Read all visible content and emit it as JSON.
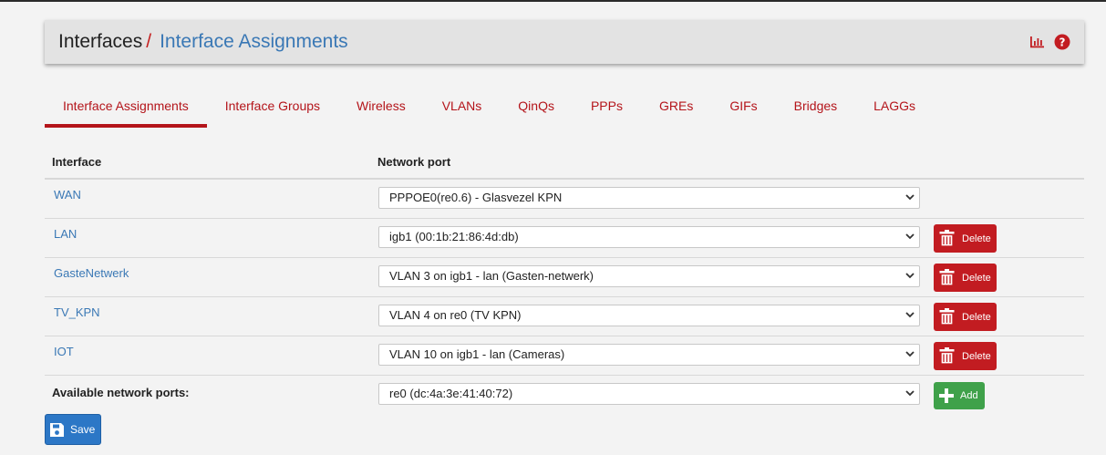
{
  "header": {
    "crumb_root": "Interfaces",
    "crumb_separator": "/",
    "crumb_current": "Interface Assignments",
    "icons": [
      "chart-icon",
      "help-icon"
    ]
  },
  "tabs": [
    {
      "label": "Interface Assignments",
      "active": true
    },
    {
      "label": "Interface Groups"
    },
    {
      "label": "Wireless"
    },
    {
      "label": "VLANs"
    },
    {
      "label": "QinQs"
    },
    {
      "label": "PPPs"
    },
    {
      "label": "GREs"
    },
    {
      "label": "GIFs"
    },
    {
      "label": "Bridges"
    },
    {
      "label": "LAGGs"
    }
  ],
  "table": {
    "col_interface": "Interface",
    "col_network_port": "Network port",
    "rows": [
      {
        "interface": "WAN",
        "port": "PPPOE0(re0.6) - Glasvezel KPN"
      },
      {
        "interface": "LAN",
        "port": "igb1 (00:1b:21:86:4d:db)",
        "action": "Delete"
      },
      {
        "interface": "GasteNetwerk",
        "port": "VLAN 3 on igb1 - lan (Gasten-netwerk)",
        "action": "Delete"
      },
      {
        "interface": "TV_KPN",
        "port": "VLAN 4 on re0 (TV KPN)",
        "action": "Delete"
      },
      {
        "interface": "IOT",
        "port": "VLAN 10 on igb1 - lan (Cameras)",
        "action": "Delete"
      }
    ],
    "available_label": "Available network ports:",
    "available_port": "re0 (dc:4a:3e:41:40:72)",
    "add_label": "Add"
  },
  "save_label": "Save",
  "colors": {
    "accent_red": "#b4141a",
    "link_blue": "#3a78b5",
    "delete_red": "#c21c21",
    "add_green": "#3fa14a",
    "save_blue": "#2c77c6"
  }
}
